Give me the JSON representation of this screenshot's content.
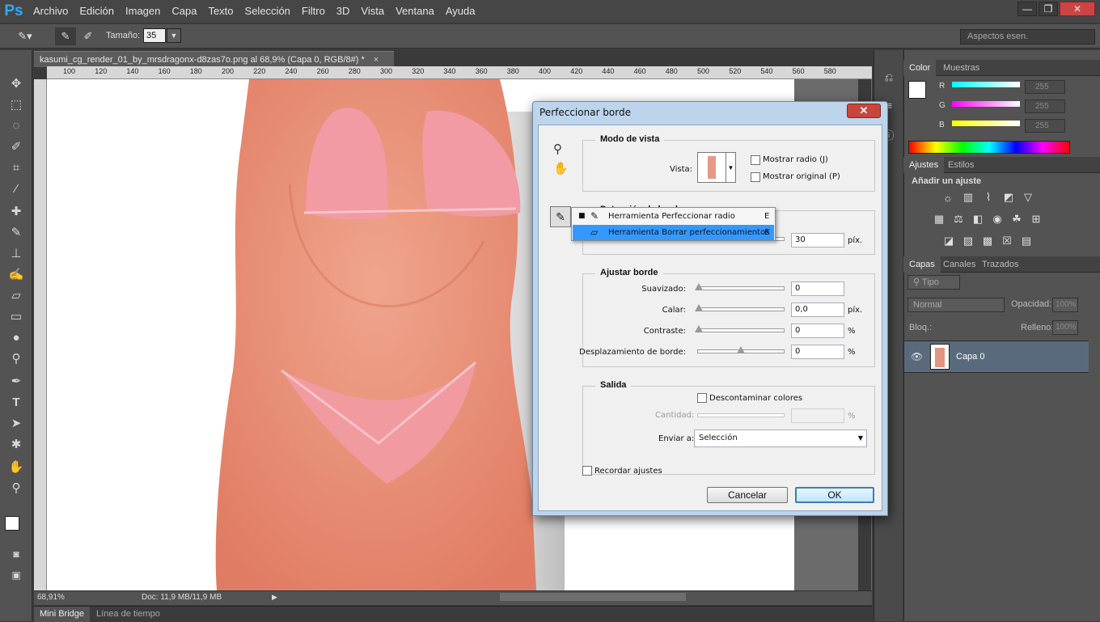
{
  "app": {
    "logo": "Ps"
  },
  "menu": [
    "Archivo",
    "Edición",
    "Imagen",
    "Capa",
    "Texto",
    "Selección",
    "Filtro",
    "3D",
    "Vista",
    "Ventana",
    "Ayuda"
  ],
  "window_controls": {
    "minimize": "—",
    "restore": "❐",
    "close": "✕"
  },
  "options_bar": {
    "size_label": "Tamaño:",
    "size_value": "35",
    "workspace": "Aspectos esen."
  },
  "document": {
    "tab_title": "kasumi_cg_render_01_by_mrsdragonx-d8zas7o.png al 68,9% (Capa 0, RGB/8#) *",
    "close": "×",
    "ruler_top": [
      "100",
      "120",
      "140",
      "160",
      "180",
      "200",
      "220",
      "240",
      "260",
      "280",
      "300",
      "320",
      "340",
      "360",
      "380",
      "400",
      "420",
      "440",
      "460",
      "480",
      "500",
      "520",
      "540",
      "560",
      "580"
    ]
  },
  "status": {
    "zoom": "68,91%",
    "doc": "Doc: 11,9 MB/11,9 MB"
  },
  "bottom_tabs": [
    "Mini Bridge",
    "Línea de tiempo"
  ],
  "color_panel": {
    "tabs": [
      "Color",
      "Muestras"
    ],
    "channels": [
      {
        "label": "R",
        "value": "255",
        "color": "#00ffff"
      },
      {
        "label": "G",
        "value": "255",
        "color": "#ff00ff"
      },
      {
        "label": "B",
        "value": "255",
        "color": "#ffff00"
      }
    ]
  },
  "adjust_panel": {
    "tabs": [
      "Ajustes",
      "Estilos"
    ],
    "add_label": "Añadir un ajuste"
  },
  "layers_panel": {
    "tabs": [
      "Capas",
      "Canales",
      "Trazados"
    ],
    "filter": "Tipo",
    "blend_mode": "Normal",
    "opacity_label": "Opacidad:",
    "opacity_value": "100%",
    "lock_label": "Bloq.:",
    "fill_label": "Relleno:",
    "fill_value": "100%",
    "layers": [
      {
        "name": "Capa 0"
      }
    ]
  },
  "dialog": {
    "title": "Perfeccionar borde",
    "close": "✕",
    "view_mode": {
      "title": "Modo de vista",
      "view_label": "Vista:",
      "show_radius": "Mostrar radio (J)",
      "show_original": "Mostrar original (P)"
    },
    "edge_detection": {
      "title": "Detección de borde",
      "radius_value": "30",
      "radius_unit": "píx."
    },
    "flyout": [
      {
        "label": "Herramienta Perfeccionar radio",
        "key": "E",
        "selected": false
      },
      {
        "label": "Herramienta Borrar perfeccionamientos",
        "key": "E",
        "selected": true
      }
    ],
    "adjust_edge": {
      "title": "Ajustar borde",
      "rows": [
        {
          "label": "Suavizado:",
          "value": "0",
          "unit": "",
          "position": 0.0
        },
        {
          "label": "Calar:",
          "value": "0,0",
          "unit": "píx.",
          "position": 0.0
        },
        {
          "label": "Contraste:",
          "value": "0",
          "unit": "%",
          "position": 0.0
        },
        {
          "label": "Desplazamiento de borde:",
          "value": "0",
          "unit": "%",
          "position": 0.5
        }
      ]
    },
    "output": {
      "title": "Salida",
      "decontaminate": "Descontaminar colores",
      "amount_label": "Cantidad:",
      "amount_unit": "%",
      "send_label": "Enviar a:",
      "send_value": "Selección"
    },
    "remember": "Recordar ajustes",
    "cancel": "Cancelar",
    "ok": "OK"
  }
}
